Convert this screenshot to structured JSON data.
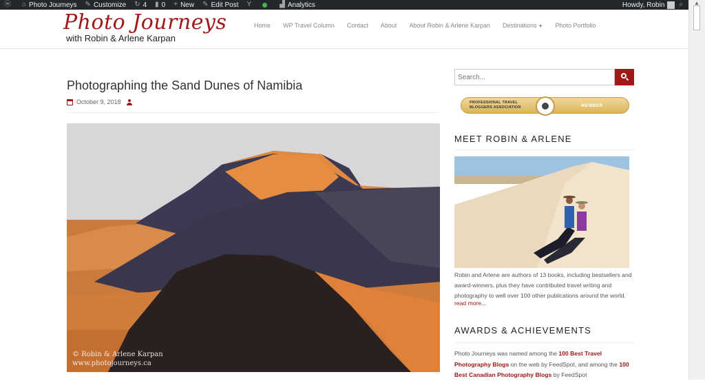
{
  "admin_bar": {
    "site_name": "Photo Journeys",
    "customize": "Customize",
    "updates_count": "4",
    "comments_count": "0",
    "new_label": "New",
    "edit_post": "Edit Post",
    "analytics": "Analytics",
    "howdy": "Howdy, Robin"
  },
  "logo": {
    "title": "Photo Journeys",
    "subtitle": "with Robin & Arlene Karpan"
  },
  "nav": {
    "items": [
      "Home",
      "WP Travel Column",
      "Contact",
      "About",
      "About Robin & Arlene Karpan",
      "Destinations",
      "Photo Portfolio"
    ]
  },
  "post": {
    "title": "Photographing the Sand Dunes of Namibia",
    "date": "October 9, 2018",
    "watermark_line1": "© Robin & Arlene Karpan",
    "watermark_line2": "www.photojourneys.ca"
  },
  "sidebar": {
    "search_placeholder": "Search...",
    "badge_left_line1": "PROFESSIONAL TRAVEL",
    "badge_left_line2": "BLOGGERS ASSOCIATION",
    "badge_right": "MEMBER",
    "meet_title": "MEET ROBIN & ARLENE",
    "bio": "Robin and Arlene are authors of 13 books, including bestsellers and award-winners, plus they have contributed travel writing and photography to well over 100 other publications around the world.",
    "read_more": "read more...",
    "awards_title": "AWARDS & ACHIEVEMENTS",
    "awards_text_1": "Photo Journeys was named among the ",
    "awards_link_1": "100 Best Travel Photography Blogs",
    "awards_text_2": " on the web by FeedSpot, and among the ",
    "awards_link_2": "100 Best Canadian Photography Blogs",
    "awards_text_3": " by FeedSpot"
  },
  "colors": {
    "brand": "#a01818",
    "admin_bar": "#23282d"
  }
}
